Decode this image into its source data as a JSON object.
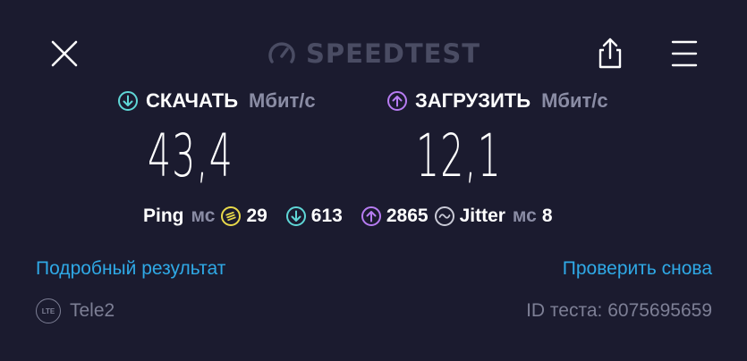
{
  "header": {
    "logo_text": "SPEEDTEST",
    "close_icon": "close-icon",
    "share_icon": "share-icon",
    "menu_icon": "menu-icon"
  },
  "download": {
    "label": "СКАЧАТЬ",
    "unit": "Мбит/с",
    "value": "43,4",
    "accent": "#5fd6d6"
  },
  "upload": {
    "label": "ЗАГРУЗИТЬ",
    "unit": "Мбит/с",
    "value": "12,1",
    "accent": "#b77cf2"
  },
  "stats": {
    "ping_label": "Ping",
    "ping_unit": "мс",
    "ping_idle": "29",
    "ping_download": "613",
    "ping_upload": "2865",
    "jitter_label": "Jitter",
    "jitter_unit": "мс",
    "jitter_value": "8",
    "idle_color": "#e8d94a"
  },
  "links": {
    "details": "Подробный результат",
    "retest": "Проверить снова",
    "color": "#2fa9e6"
  },
  "footer": {
    "network_badge": "LTE",
    "provider": "Tele2",
    "test_id": "ID теста: 6075695659"
  }
}
